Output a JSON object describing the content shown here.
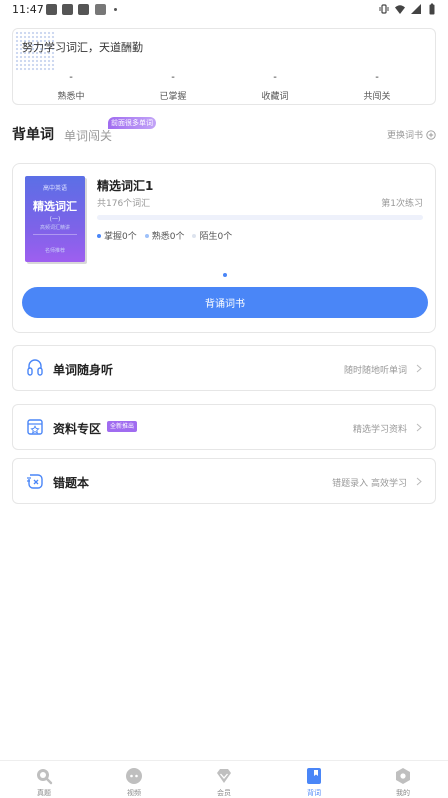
{
  "status_bar": {
    "time": "11:47"
  },
  "motto": {
    "text": "努力学习词汇，天道酬勤",
    "stats": [
      {
        "value": "-",
        "label": "熟悉中"
      },
      {
        "value": "-",
        "label": "已掌握"
      },
      {
        "value": "-",
        "label": "收藏词"
      },
      {
        "value": "-",
        "label": "共闯关"
      }
    ]
  },
  "tabs": {
    "active": "背单词",
    "other": "单词闯关",
    "badge": "前面很多单词",
    "change_book": "更换词书"
  },
  "book": {
    "cover": {
      "top": "高中英语",
      "title": "精选词汇",
      "vol": "(一)",
      "sub": "高频词汇精讲",
      "foot": "名师推荐"
    },
    "title": "精选词汇1",
    "count": "共176个词汇",
    "times": "第1次练习",
    "progress": 0.0,
    "legend": [
      {
        "label": "掌握0个",
        "color": "#4a86f7"
      },
      {
        "label": "熟悉0个",
        "color": "#9ec1fa"
      },
      {
        "label": "陌生0个",
        "color": "#dde3ee"
      }
    ],
    "button": "背诵词书"
  },
  "features": [
    {
      "title": "单词随身听",
      "hint": "随时随地听单词",
      "badge": "",
      "icon": "headphones-icon"
    },
    {
      "title": "资料专区",
      "hint": "精选学习资料",
      "badge": "全新推出",
      "icon": "folder-star-icon"
    },
    {
      "title": "错题本",
      "hint": "错题录入 高效学习",
      "badge": "",
      "icon": "wrong-notebook-icon"
    }
  ],
  "nav": [
    {
      "label": "真题",
      "icon": "search-icon",
      "active": false
    },
    {
      "label": "视频",
      "icon": "video-icon",
      "active": false
    },
    {
      "label": "会员",
      "icon": "diamond-icon",
      "active": false
    },
    {
      "label": "背词",
      "icon": "book-icon",
      "active": true
    },
    {
      "label": "我的",
      "icon": "profile-icon",
      "active": false
    }
  ]
}
